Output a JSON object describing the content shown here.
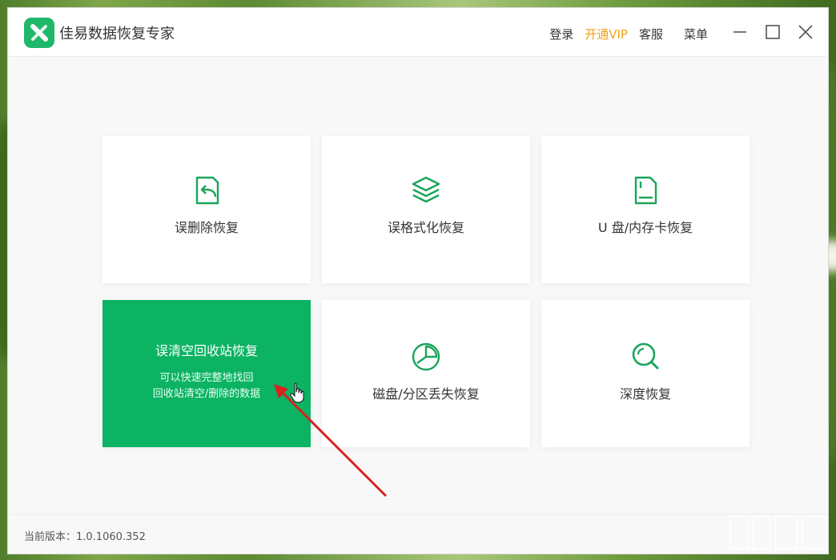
{
  "app": {
    "title": "佳易数据恢复专家"
  },
  "topnav": {
    "login": "登录",
    "vip": "开通VIP",
    "service": "客服",
    "menu": "菜单"
  },
  "cards": [
    {
      "label": "误删除恢复",
      "icon": "file-restore-icon"
    },
    {
      "label": "误格式化恢复",
      "icon": "layers-icon"
    },
    {
      "label": "U 盘/内存卡恢复",
      "icon": "sd-card-icon"
    },
    {
      "label": "误清空回收站恢复",
      "desc_line1": "可以快速完整地找回",
      "desc_line2": "回收站清空/删除的数据"
    },
    {
      "label": "磁盘/分区丢失恢复",
      "icon": "pie-chart-icon"
    },
    {
      "label": "深度恢复",
      "icon": "magnifier-icon"
    }
  ],
  "footer": {
    "version": "当前版本：1.0.1060.352"
  },
  "colors": {
    "accent": "#0bb362",
    "vip": "#f0a21b",
    "icon": "#1aa55a"
  }
}
